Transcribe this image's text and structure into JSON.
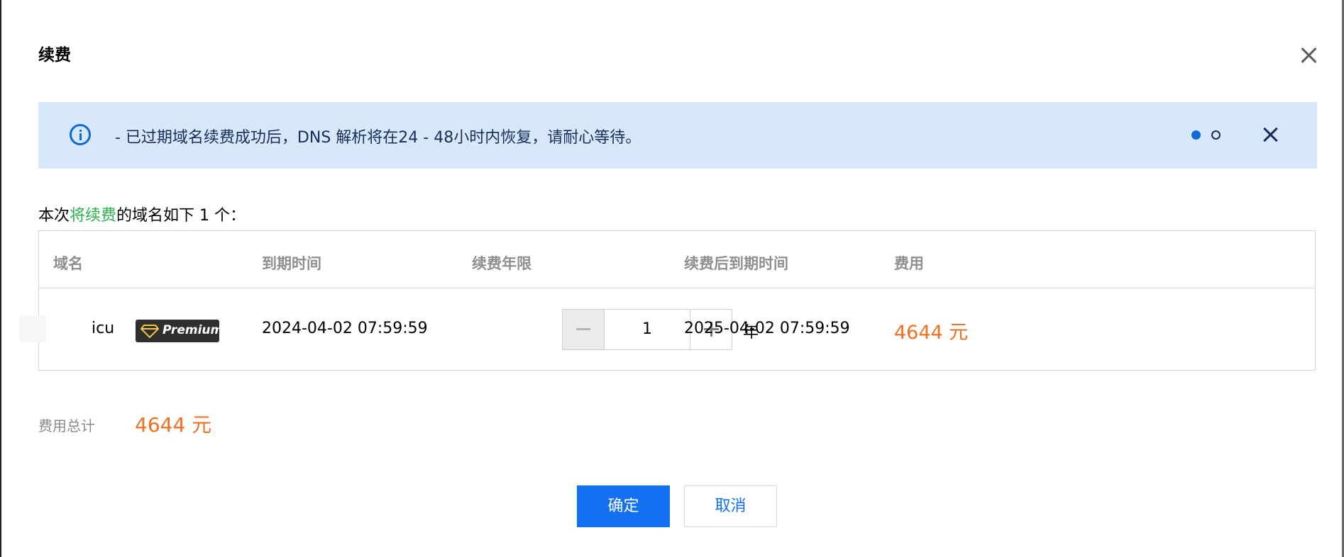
{
  "dialog": {
    "title": "续费"
  },
  "alert": {
    "message": "- 已过期域名续费成功后，DNS 解析将在24 - 48小时内恢复，请耐心等待。",
    "pager_total": 2,
    "pager_current": 1
  },
  "summary": {
    "prefix": "本次",
    "highlight": "将续费",
    "suffix": "的域名如下 1 个："
  },
  "table": {
    "headers": [
      "域名",
      "到期时间",
      "续费年限",
      "续费后到期时间",
      "费用"
    ],
    "rows": [
      {
        "domain": "icu",
        "badge": "Premium",
        "expiry": "2024-04-02 07:59:59",
        "years": "1",
        "years_unit": "年",
        "new_expiry": "2025-04-02 07:59:59",
        "fee": "4644 元"
      }
    ]
  },
  "total": {
    "label": "费用总计",
    "value": "4644  元"
  },
  "buttons": {
    "confirm": "确定",
    "cancel": "取消"
  },
  "colors": {
    "primary": "#1270f1",
    "price": "#f07021",
    "highlight_green": "#29b34a",
    "alert_bg": "#d7e8fb"
  },
  "icons": {
    "info": "info-circle-icon",
    "close": "close-icon",
    "premium": "diamond-icon"
  }
}
